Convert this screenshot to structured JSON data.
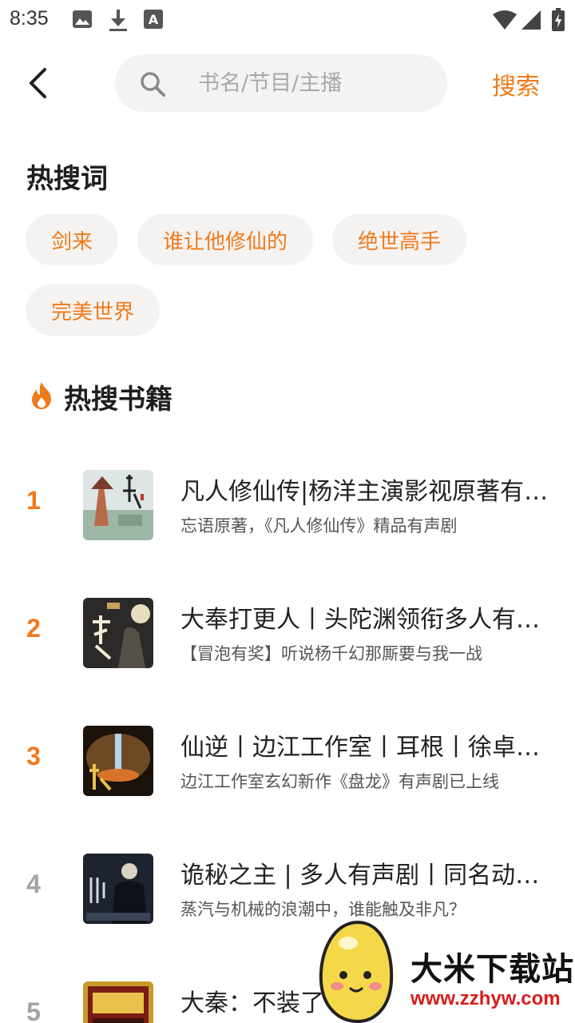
{
  "status_bar": {
    "time": "8:35",
    "icons": [
      "image-icon",
      "download-icon",
      "font-icon",
      "wifi-icon",
      "signal-icon",
      "battery-icon"
    ]
  },
  "header": {
    "back_icon": "chevron-left-icon",
    "search": {
      "placeholder": "书名/节目/主播",
      "value": "",
      "icon": "search-icon"
    },
    "search_button": "搜索"
  },
  "hot_words": {
    "title": "热搜词",
    "items": [
      "剑来",
      "谁让他修仙的",
      "绝世高手",
      "完美世界"
    ]
  },
  "hot_books": {
    "title": "热搜书籍",
    "icon": "fire-icon",
    "items": [
      {
        "rank": "1",
        "title": "凡人修仙传|杨洋主演影视原著有声剧",
        "desc": "忘语原著，《凡人修仙传》精品有声剧",
        "rank_color": "#f07a1a"
      },
      {
        "rank": "2",
        "title": "大奉打更人丨头陀渊领衔多人有声剧",
        "desc": "【冒泡有奖】听说杨千幻那厮要与我一战",
        "rank_color": "#f07a1a"
      },
      {
        "rank": "3",
        "title": "仙逆丨边江工作室丨耳根丨徐卓有声剧",
        "desc": "边江工作室玄幻新作《盘龙》有声剧已上线",
        "rank_color": "#f07a1a"
      },
      {
        "rank": "4",
        "title": "诡秘之主 | 多人有声剧丨同名动画原著",
        "desc": "蒸汽与机械的浪潮中，谁能触及非凡？",
        "rank_color": "#a3a3a3"
      },
      {
        "rank": "5",
        "title": "大秦：不装了",
        "desc": "",
        "rank_color": "#a3a3a3"
      }
    ]
  },
  "watermark": {
    "text": "大米下载站",
    "url": "www.zzhyw.com"
  },
  "colors": {
    "accent": "#f07a1a",
    "chip_bg": "#f5f3f1",
    "search_bg": "#f3f3f3"
  }
}
